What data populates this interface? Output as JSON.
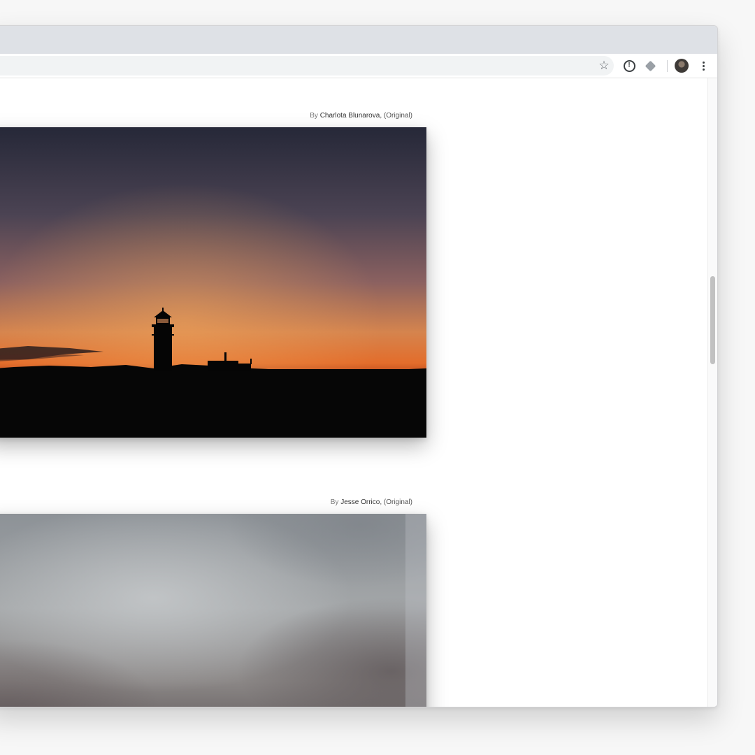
{
  "toolbar": {
    "icons": [
      "star-icon",
      "info-icon",
      "extension-icon",
      "avatar",
      "menu-icon"
    ]
  },
  "credits": [
    {
      "by": "By",
      "author": "Charlota Blunarova",
      "original": ", (Original)"
    },
    {
      "by": "By",
      "author": "Jesse Orrico",
      "original": ", (Original)"
    }
  ],
  "photos": [
    {
      "subject": "lighthouse-sunset",
      "colors": {
        "sky_top": "#262838",
        "horizon": "#e36d2b",
        "ground": "#060606"
      }
    },
    {
      "subject": "blurred-gray",
      "colors": {
        "light": "#adb1b6",
        "dark": "#6d6e72"
      }
    }
  ],
  "colors": {
    "tabstrip": "#dee1e6",
    "omnibox": "#f1f3f4",
    "page": "#ffffff"
  }
}
